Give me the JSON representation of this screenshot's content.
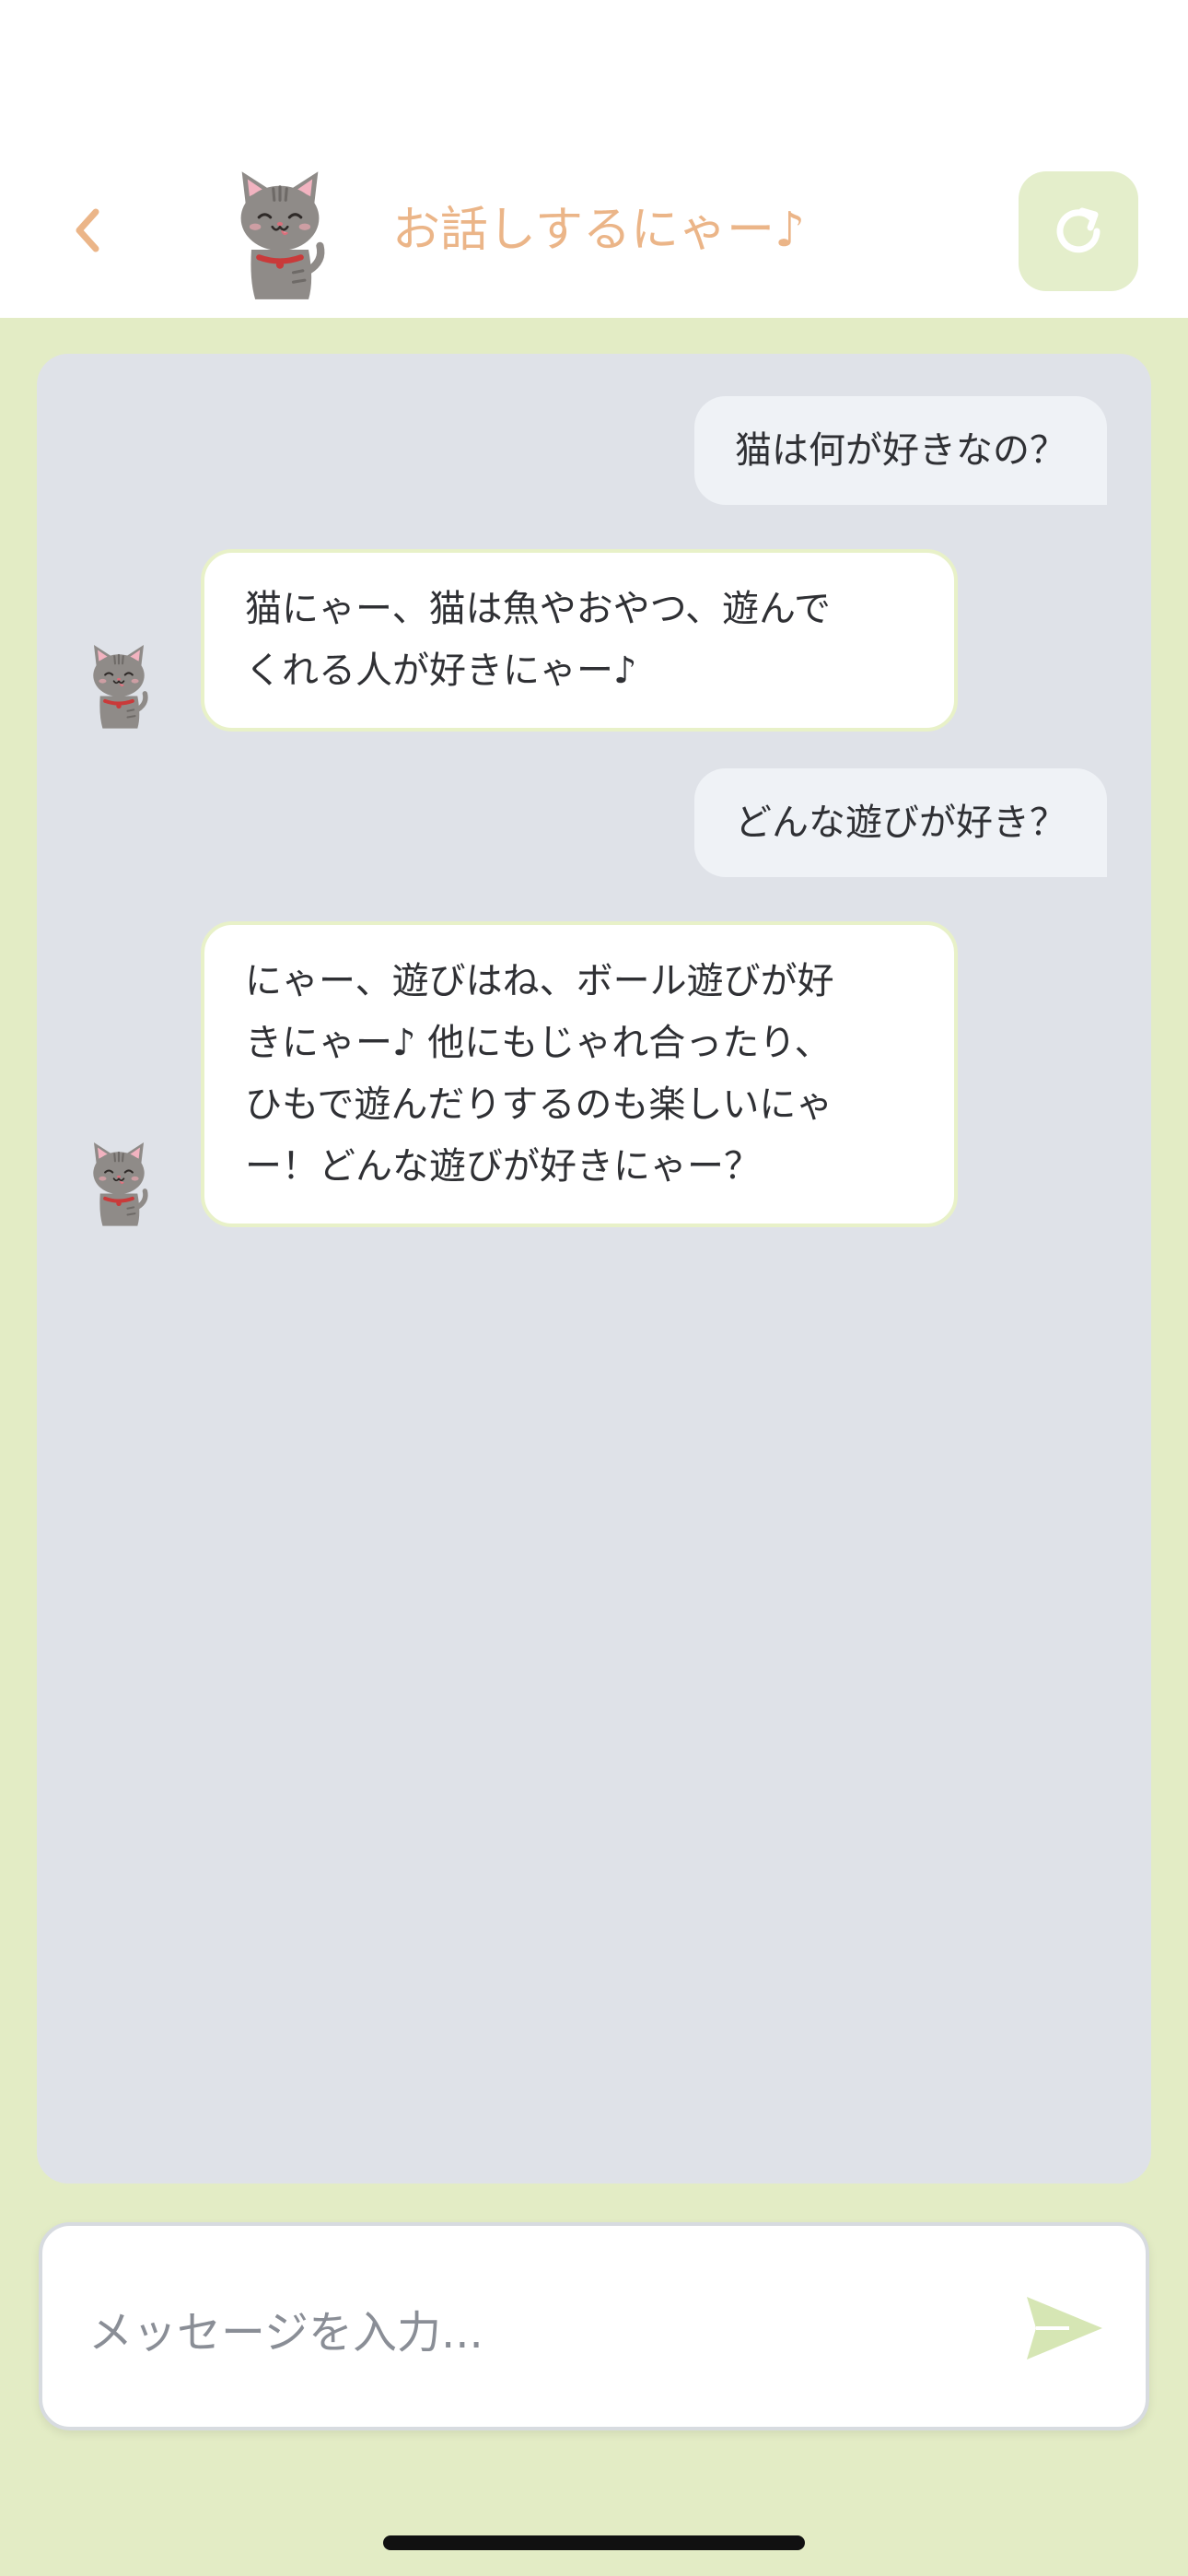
{
  "header": {
    "title": "お話しするにゃー♪",
    "back_icon": "chevron-left-icon",
    "refresh_icon": "refresh-icon",
    "avatar": "cat-avatar"
  },
  "colors": {
    "accent": "#ebb588",
    "header_bg": "#ffffff",
    "app_bg": "#e3ecc5",
    "chat_panel_bg": "#dfe2e8",
    "user_bubble_bg": "#eff2f6",
    "bot_bubble_bg": "#ffffff",
    "bot_bubble_border": "#e8f1c8",
    "refresh_button_bg": "#e4eecb",
    "send_icon": "#d6e6b4"
  },
  "messages": [
    {
      "role": "user",
      "text": "猫は何が好きなの？"
    },
    {
      "role": "bot",
      "lines": [
        "猫にゃー、猫は魚やおやつ、遊んで",
        "くれる人が好きにゃー♪"
      ]
    },
    {
      "role": "user",
      "text": "どんな遊びが好き？"
    },
    {
      "role": "bot",
      "lines": [
        "にゃー、遊びはね、ボール遊びが好",
        "きにゃー♪ 他にもじゃれ合ったり、",
        "ひもで遊んだりするのも楽しいにゃ",
        "ー！どんな遊びが好きにゃー？"
      ]
    }
  ],
  "input": {
    "placeholder": "メッセージを入力...",
    "value": "",
    "send_icon": "send-icon"
  }
}
